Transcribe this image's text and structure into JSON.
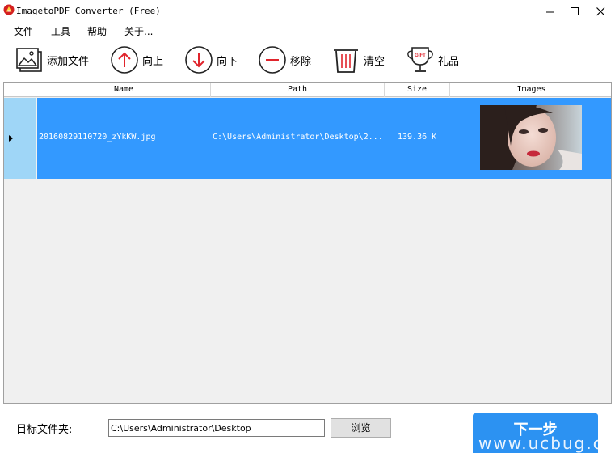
{
  "window": {
    "title": "ImagetoPDF Converter (Free)"
  },
  "menu": [
    {
      "label": "文件"
    },
    {
      "label": "工具"
    },
    {
      "label": "帮助"
    },
    {
      "label": "关于..."
    }
  ],
  "toolbar": {
    "add_files": "添加文件",
    "move_up": "向上",
    "move_down": "向下",
    "remove": "移除",
    "clear": "清空",
    "gift": "礼品",
    "gift_badge": "GIFT"
  },
  "grid": {
    "columns": [
      "Name",
      "Path",
      "Size",
      "Images"
    ],
    "rows": [
      {
        "name": "20160829110720_zYkKW.jpg",
        "path": "C:\\Users\\Administrator\\Desktop\\2...",
        "size": "139.36 K",
        "thumbnail": "portrait-photo"
      }
    ]
  },
  "footer": {
    "target_label": "目标文件夹:",
    "target_value": "C:\\Users\\Administrator\\Desktop",
    "browse": "浏览",
    "next": "下一步",
    "watermark": "www.ucbug.c"
  },
  "colors": {
    "selection": "#3399ff",
    "row_selector": "#9fd6f7",
    "next_button": "#2c92f2",
    "icon_red": "#e0242c"
  }
}
